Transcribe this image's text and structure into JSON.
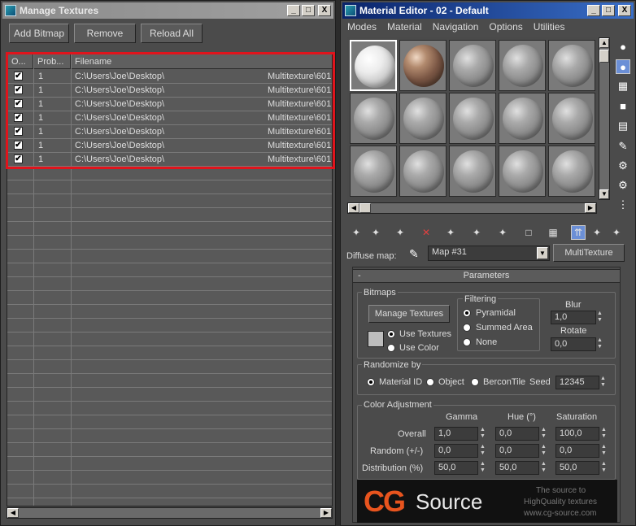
{
  "manage_textures": {
    "title": "Manage Textures",
    "buttons": {
      "add": "Add Bitmap",
      "remove": "Remove",
      "reload": "Reload All"
    },
    "columns": {
      "on": "O...",
      "prob": "Prob...",
      "filename": "Filename"
    },
    "rows": [
      {
        "checked": true,
        "prob": "1",
        "path": "C:\\Users\\Joe\\Desktop\\",
        "suffix": "Multitexture\\601"
      },
      {
        "checked": true,
        "prob": "1",
        "path": "C:\\Users\\Joe\\Desktop\\",
        "suffix": "Multitexture\\601"
      },
      {
        "checked": true,
        "prob": "1",
        "path": "C:\\Users\\Joe\\Desktop\\",
        "suffix": "Multitexture\\601"
      },
      {
        "checked": true,
        "prob": "1",
        "path": "C:\\Users\\Joe\\Desktop\\",
        "suffix": "Multitexture\\601"
      },
      {
        "checked": true,
        "prob": "1",
        "path": "C:\\Users\\Joe\\Desktop\\",
        "suffix": "Multitexture\\601"
      },
      {
        "checked": true,
        "prob": "1",
        "path": "C:\\Users\\Joe\\Desktop\\",
        "suffix": "Multitexture\\601"
      },
      {
        "checked": true,
        "prob": "1",
        "path": "C:\\Users\\Joe\\Desktop\\",
        "suffix": "Multitexture\\601"
      }
    ],
    "window_buttons": {
      "minimize": "_",
      "maximize": "□",
      "close": "X"
    },
    "highlight_color": "#e0141c"
  },
  "material_editor": {
    "title": "Material Editor - 02 - Default",
    "menu": [
      "Modes",
      "Material",
      "Navigation",
      "Options",
      "Utilities"
    ],
    "diffuse_label": "Diffuse map:",
    "map_name": "Map #31",
    "map_type": "MultiTexture",
    "rollout_title": "Parameters",
    "rollout_toggle": "-",
    "bitmaps": {
      "group_label": "Bitmaps",
      "manage_button": "Manage Textures",
      "use_textures": "Use Textures",
      "use_color": "Use Color",
      "filtering_label": "Filtering",
      "pyramidal": "Pyramidal",
      "summed_area": "Summed Area",
      "none": "None",
      "blur_label": "Blur",
      "blur_value": "1,0",
      "rotate_label": "Rotate",
      "rotate_value": "0,0"
    },
    "randomize": {
      "group_label": "Randomize by",
      "material_id": "Material ID",
      "object": "Object",
      "bercon_tile": "BerconTile",
      "seed_label": "Seed",
      "seed_value": "12345"
    },
    "color_adjustment": {
      "group_label": "Color Adjustment",
      "headers": {
        "gamma": "Gamma",
        "hue": "Hue (°)",
        "saturation": "Saturation"
      },
      "overall_label": "Overall",
      "random_label": "Random (+/-)",
      "distribution_label": "Distribution (%)",
      "overall": {
        "gamma": "1,0",
        "hue": "0,0",
        "saturation": "100,0"
      },
      "random": {
        "gamma": "0,0",
        "hue": "0,0",
        "saturation": "0,0"
      },
      "distribution": {
        "gamma": "50,0",
        "hue": "50,0",
        "saturation": "50,0"
      }
    },
    "banner": {
      "logo_cg": "CG",
      "logo_source": "Source",
      "tagline_1": "The source to",
      "tagline_2": "HighQuality textures",
      "url": "www.cg-source.com"
    },
    "colors": {
      "title_active": "#0a246a",
      "accent_brand": "#e8541e"
    }
  }
}
